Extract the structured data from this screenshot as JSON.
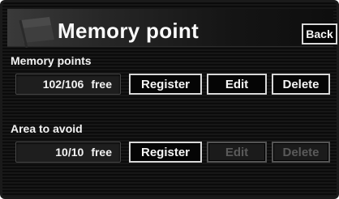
{
  "header": {
    "title": "Memory point",
    "back_label": "Back",
    "icon": "flag-icon"
  },
  "memory_points": {
    "label": "Memory points",
    "count": "102/106",
    "count_suffix": "free",
    "register_label": "Register",
    "edit_label": "Edit",
    "delete_label": "Delete"
  },
  "area_to_avoid": {
    "label": "Area to avoid",
    "count": "10/10",
    "count_suffix": "free",
    "register_label": "Register",
    "edit_label": "Edit",
    "delete_label": "Delete",
    "edit_enabled": false,
    "delete_enabled": false
  },
  "colors": {
    "background": "#111111",
    "button_border": "#d8d8d8",
    "disabled_text": "#5a5a5a"
  }
}
